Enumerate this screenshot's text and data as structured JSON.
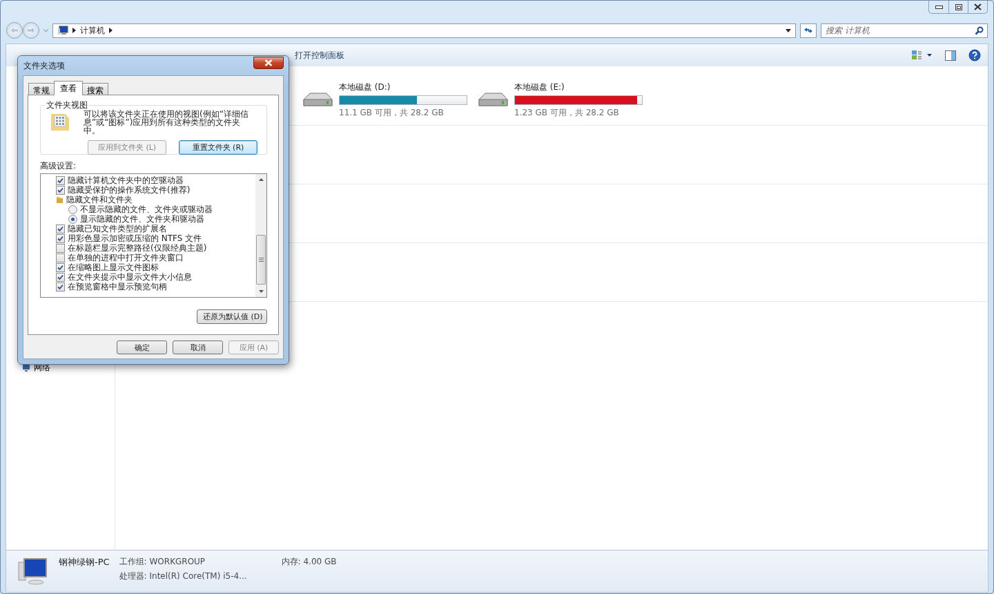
{
  "explorer": {
    "address": {
      "path": [
        "计算机"
      ]
    },
    "search": {
      "placeholder": "搜索 计算机"
    },
    "toolbar": [
      {
        "label": "打开控制面板"
      }
    ],
    "nav": [
      {
        "label": "网络"
      }
    ],
    "drives": [
      {
        "name": "本地磁盘 (D:)",
        "level": 0.61,
        "color": "#178aaa",
        "space": "11.1 GB 可用，共 28.2 GB"
      },
      {
        "name": "本地磁盘 (E:)",
        "level": 0.96,
        "color": "#d8101c",
        "space": "1.23 GB 可用，共 28.2 GB"
      }
    ],
    "details": {
      "name": "钢神绿钢-PC",
      "fields": [
        {
          "label": "工作组:",
          "value": "WORKGROUP"
        },
        {
          "label": "内存:",
          "value": "4.00 GB"
        },
        {
          "label": "处理器:",
          "value": "Intel(R) Core(TM) i5-4..."
        }
      ]
    }
  },
  "dialog": {
    "title": "文件夹选项",
    "tabs": [
      {
        "label": "常规",
        "selected": false
      },
      {
        "label": "查看",
        "selected": true
      },
      {
        "label": "搜索",
        "selected": false
      }
    ],
    "folder_views": {
      "title": "文件夹视图",
      "text": "可以将该文件夹正在使用的视图(例如“详细信息”或“图标”)应用到所有这种类型的文件夹中。",
      "buttons": [
        {
          "label": "应用到文件夹 (L)",
          "disabled": true
        },
        {
          "label": "重置文件夹 (R)",
          "disabled": false
        }
      ]
    },
    "advanced_label": "高级设置:",
    "settings": [
      {
        "kind": "checkbox",
        "label": "隐藏计算机文件夹中的空驱动器",
        "checked": true
      },
      {
        "kind": "checkbox",
        "label": "隐藏受保护的操作系统文件(推荐)",
        "checked": true
      },
      {
        "kind": "folder",
        "label": "隐藏文件和文件夹",
        "children": [
          {
            "kind": "radio",
            "label": "不显示隐藏的文件、文件夹或驱动器",
            "selected": false
          },
          {
            "kind": "radio",
            "label": "显示隐藏的文件、文件夹和驱动器",
            "selected": true
          }
        ]
      },
      {
        "kind": "checkbox",
        "label": "隐藏已知文件类型的扩展名",
        "checked": true
      },
      {
        "kind": "checkbox",
        "label": "用彩色显示加密或压缩的 NTFS 文件",
        "checked": true
      },
      {
        "kind": "checkbox",
        "label": "在标题栏显示完整路径(仅限经典主题)",
        "checked": false
      },
      {
        "kind": "checkbox",
        "label": "在单独的进程中打开文件夹窗口",
        "checked": false
      },
      {
        "kind": "checkbox",
        "label": "在缩略图上显示文件图标",
        "checked": true
      },
      {
        "kind": "checkbox",
        "label": "在文件夹提示中显示文件大小信息",
        "checked": true
      },
      {
        "kind": "checkbox",
        "label": "在预览窗格中显示预览句柄",
        "checked": true
      }
    ],
    "restore_button": "还原为默认值 (D)",
    "buttons": [
      {
        "label": "确定",
        "disabled": false
      },
      {
        "label": "取消",
        "disabled": false
      },
      {
        "label": "应用 (A)",
        "disabled": true
      }
    ]
  }
}
